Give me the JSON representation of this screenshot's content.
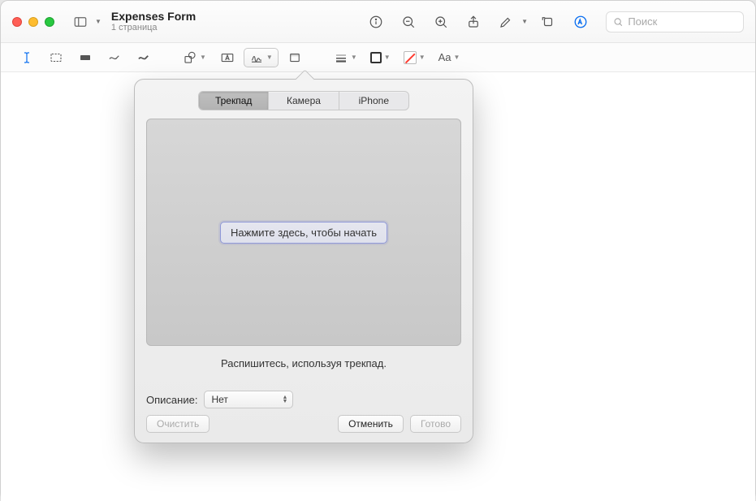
{
  "titlebar": {
    "doc_title": "Expenses Form",
    "doc_subtitle": "1 страница",
    "search_placeholder": "Поиск"
  },
  "popover": {
    "tabs": {
      "trackpad": "Трекпад",
      "camera": "Камера",
      "iphone": "iPhone"
    },
    "click_to_start": "Нажмите здесь, чтобы начать",
    "hint": "Распишитесь, используя трекпад.",
    "description_label": "Описание:",
    "description_value": "Нет",
    "buttons": {
      "clear": "Очистить",
      "cancel": "Отменить",
      "done": "Готово"
    }
  },
  "markupbar": {
    "text_style_label": "Aa"
  }
}
